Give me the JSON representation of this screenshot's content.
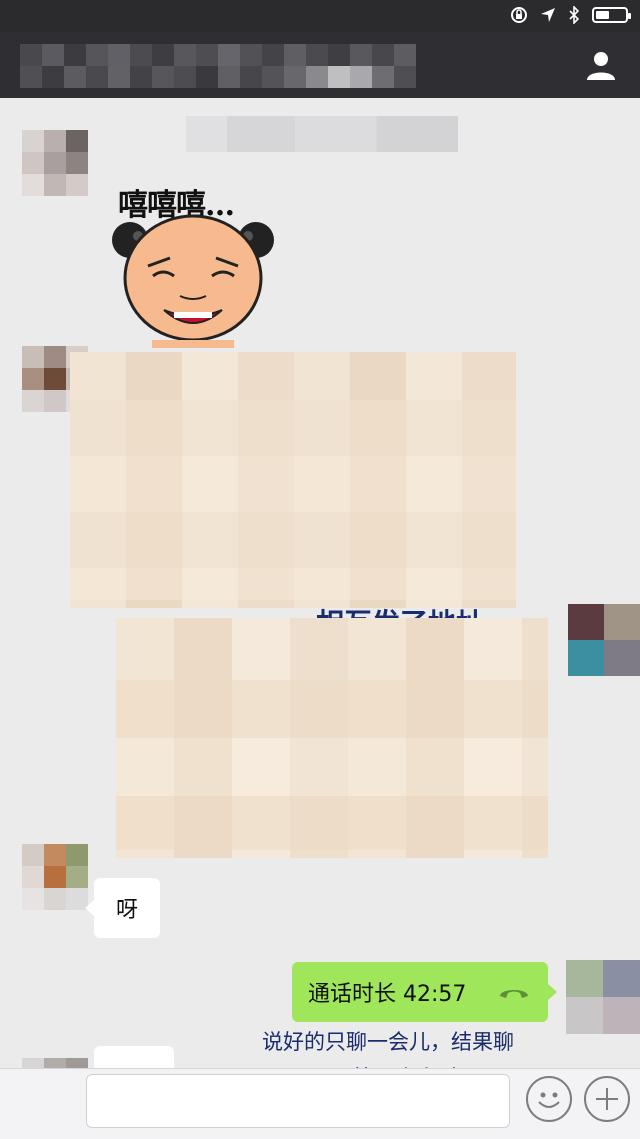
{
  "status_bar": {
    "icons": [
      "lock-rotation-icon",
      "location-icon",
      "bluetooth-icon",
      "battery-icon"
    ],
    "battery_level": 0.45
  },
  "nav": {
    "profile_icon": "person-icon"
  },
  "sticker": {
    "text": "嘻嘻嘻…"
  },
  "captions": {
    "address": "相互发了地址",
    "summary_line1": "说好的只聊一会儿，结果聊",
    "summary_line2": "了快一个小时"
  },
  "messages": {
    "incoming_text": "呀",
    "call_label": "通话时长 42:57",
    "call_icon": "phone-hangup-icon"
  },
  "input_bar": {
    "emoji_icon": "emoji-icon",
    "plus_icon": "plus-icon"
  },
  "colors": {
    "nav_bg": "#2f2f33",
    "chat_bg": "#ebebeb",
    "outgoing_bubble": "#9fe65a",
    "caption_color": "#1a2c6e"
  }
}
